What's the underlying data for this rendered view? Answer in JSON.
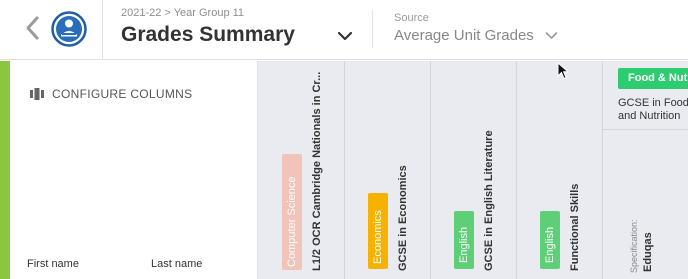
{
  "header": {
    "breadcrumb": "2021-22 > Year Group 11",
    "title": "Grades Summary",
    "source_label": "Source",
    "source_value": "Average Unit Grades"
  },
  "left_panel": {
    "configure_label": "CONFIGURE COLUMNS",
    "columns": {
      "first_name": "First name",
      "last_name": "Last name"
    }
  },
  "subject_columns": [
    {
      "subject": "Computer Science",
      "qualification": "L1/2 OCR Cambridge Nationals in Cr...",
      "color": "#f2c4b9"
    },
    {
      "subject": "Economics",
      "qualification": "GCSE in Economics",
      "color": "#f5b200"
    },
    {
      "subject": "English",
      "qualification": "GCSE in English Literature",
      "color": "#5fcf77"
    },
    {
      "subject": "English",
      "qualification": "Functional Skills",
      "color": "#5fcf77"
    }
  ],
  "food_column": {
    "badge": "Food & Nutr",
    "title_line1": "GCSE in Food",
    "title_line2": "and Nutrition",
    "color": "#2ecc71",
    "spec_label": "Specification:",
    "spec_value": "Eduqas"
  }
}
